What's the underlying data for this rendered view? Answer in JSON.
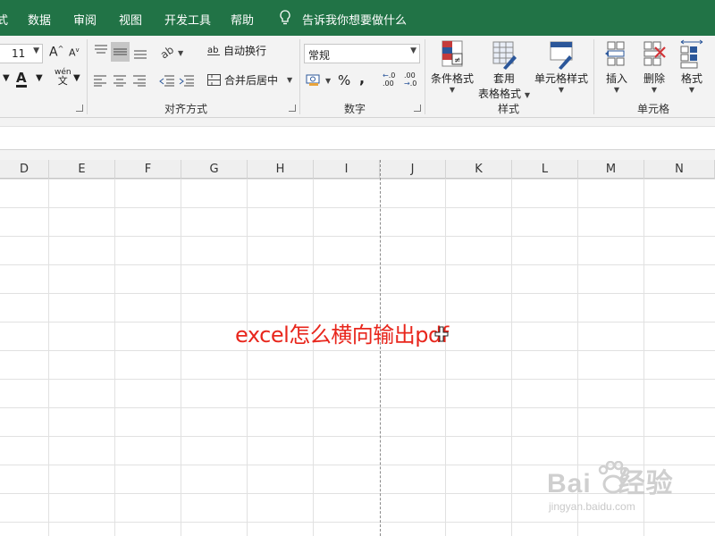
{
  "menu": {
    "partial_tab": "式",
    "tabs": [
      "数据",
      "审阅",
      "视图",
      "开发工具",
      "帮助"
    ],
    "tell_me": "告诉我你想要做什么"
  },
  "ribbon": {
    "font": {
      "size": "11",
      "grow_label": "A",
      "shrink_label": "A",
      "color_label": "A",
      "phonetic_label": "文",
      "phonetic_top": "wén"
    },
    "alignment": {
      "wrap_text": "自动换行",
      "wrap_icon_text": "ab",
      "merge_center": "合并后居中",
      "group_label": "对齐方式"
    },
    "number": {
      "format": "常规",
      "percent": "%",
      "comma": ",",
      "increase_decimal": ".00",
      "decrease_decimal": ".0",
      "group_label": "数字"
    },
    "styles": {
      "conditional_formatting": "条件格式",
      "format_as_table_1": "套用",
      "format_as_table_2": "表格格式",
      "cell_styles": "单元格样式",
      "group_label": "样式"
    },
    "cells": {
      "insert": "插入",
      "delete": "删除",
      "format": "格式",
      "group_label": "单元格"
    }
  },
  "columns": [
    "D",
    "E",
    "F",
    "G",
    "H",
    "I",
    "J",
    "K",
    "L",
    "M",
    "N"
  ],
  "overlay_text": "excel怎么横向输出pdf",
  "watermark": {
    "brand": "Bai",
    "brand2": "经验",
    "url": "jingyan.baidu.com"
  },
  "colors": {
    "excel_green": "#217346",
    "overlay_red": "#e8261c"
  }
}
